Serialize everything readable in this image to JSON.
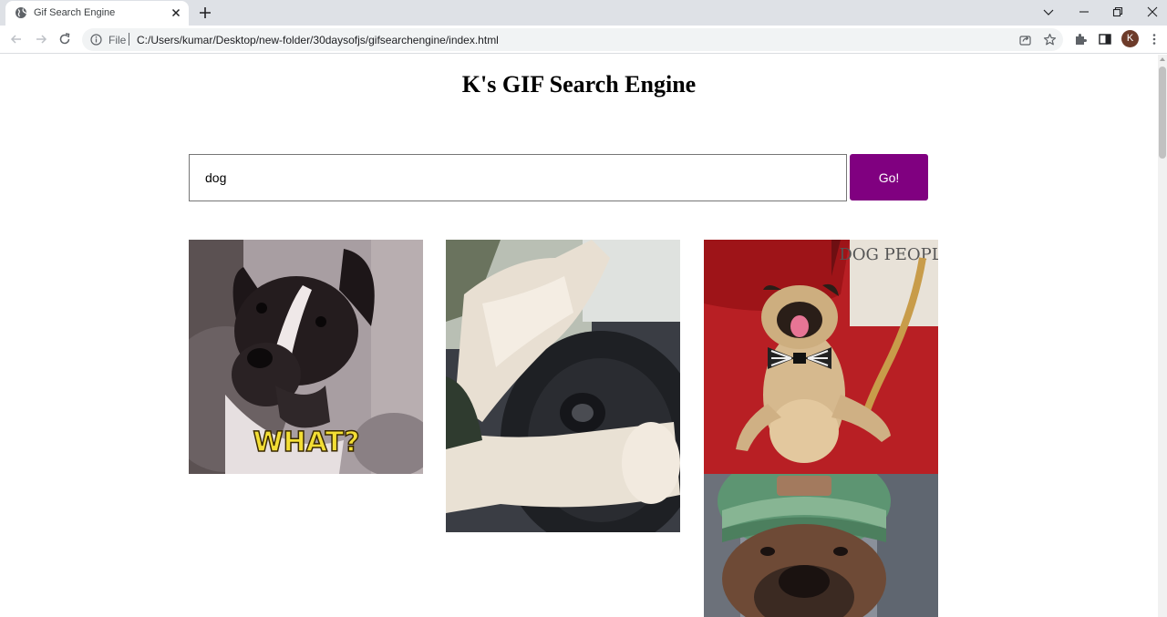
{
  "browser": {
    "tab_title": "Gif Search Engine",
    "scheme_label": "File",
    "url": "C:/Users/kumar/Desktop/new-folder/30daysofjs/gifsearchengine/index.html",
    "profile_initial": "K"
  },
  "page": {
    "title": "K's GIF Search Engine",
    "search": {
      "value": "dog",
      "placeholder": ""
    },
    "go_label": "Go!",
    "results": [
      {
        "caption": "WHAT?",
        "subject": "black and white dog tilting head"
      },
      {
        "subject": "dog paws on steering wheel"
      },
      {
        "subject": "pug lying on back wearing bow tie",
        "sign_text": "DOG PEOPL"
      },
      {
        "subject": "dog wearing green knit beanie"
      }
    ]
  },
  "colors": {
    "accent": "#800080",
    "tabstrip": "#dee1e6",
    "omnibox": "#f1f3f4"
  },
  "icons": [
    "globe-icon",
    "close-icon",
    "plus-icon",
    "chevron-down-icon",
    "minimize-icon",
    "restore-icon",
    "back-icon",
    "forward-icon",
    "reload-icon",
    "info-icon",
    "share-icon",
    "star-icon",
    "puzzle-icon",
    "sidepanel-icon",
    "kebab-menu-icon"
  ]
}
